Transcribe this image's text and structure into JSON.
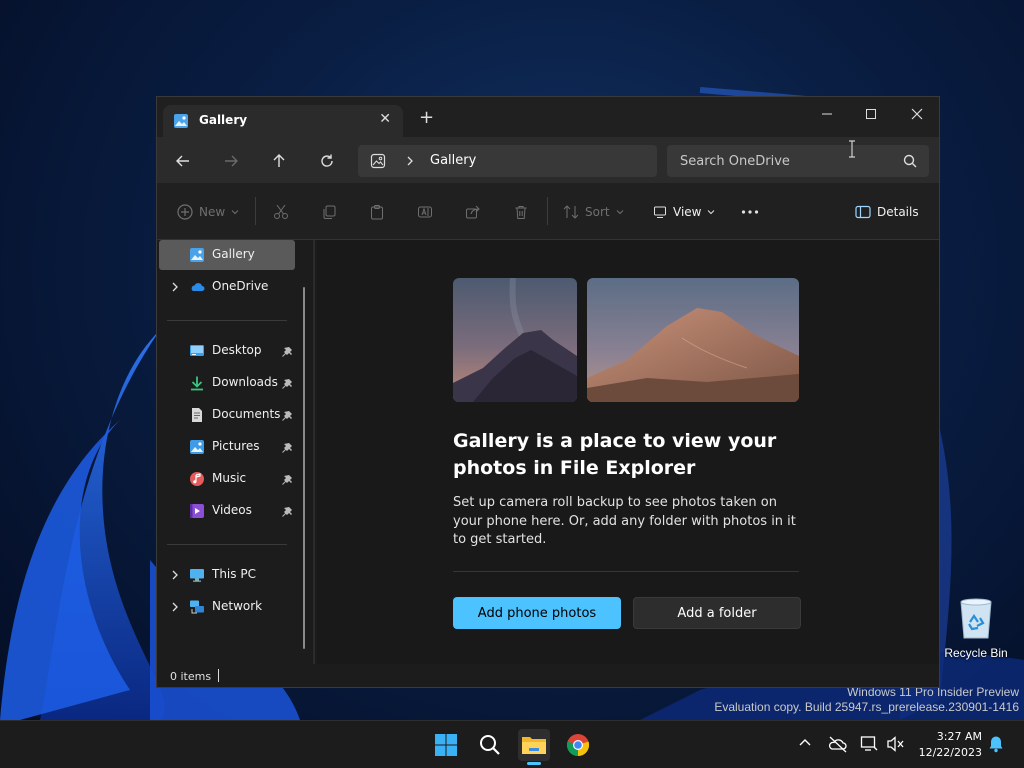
{
  "desktop": {
    "recycle_bin_label": "Recycle Bin",
    "watermark_line1": "Windows 11 Pro Insider Preview",
    "watermark_line2": "Evaluation copy. Build 25947.rs_prerelease.230901-1416"
  },
  "window": {
    "tab_title": "Gallery",
    "address_current": "Gallery",
    "search_placeholder": "Search OneDrive"
  },
  "toolbar": {
    "new_label": "New",
    "sort_label": "Sort",
    "view_label": "View",
    "details_label": "Details"
  },
  "sidebar": {
    "top": [
      {
        "label": "Gallery",
        "icon": "gallery-icon"
      },
      {
        "label": "OneDrive",
        "icon": "onedrive-cloud-icon"
      }
    ],
    "quick_access": [
      {
        "label": "Desktop",
        "icon": "desktop-icon"
      },
      {
        "label": "Downloads",
        "icon": "download-icon"
      },
      {
        "label": "Documents",
        "icon": "document-icon"
      },
      {
        "label": "Pictures",
        "icon": "pictures-icon"
      },
      {
        "label": "Music",
        "icon": "music-icon"
      },
      {
        "label": "Videos",
        "icon": "video-icon"
      }
    ],
    "bottom": [
      {
        "label": "This PC",
        "icon": "monitor-icon"
      },
      {
        "label": "Network",
        "icon": "network-icon"
      }
    ]
  },
  "gallery": {
    "headline": "Gallery is a place to view your photos in File Explorer",
    "description": "Set up camera roll backup to see photos taken on your phone here. Or, add any folder with photos in it to get started.",
    "primary_button": "Add phone photos",
    "secondary_button": "Add a folder"
  },
  "statusbar": {
    "item_count": "0 items"
  },
  "taskbar": {
    "time": "3:27 AM",
    "date": "12/22/2023"
  },
  "colors": {
    "accent": "#4cc2ff",
    "window_bg": "#1c1c1c",
    "navbar_bg": "#2b2b2b"
  }
}
